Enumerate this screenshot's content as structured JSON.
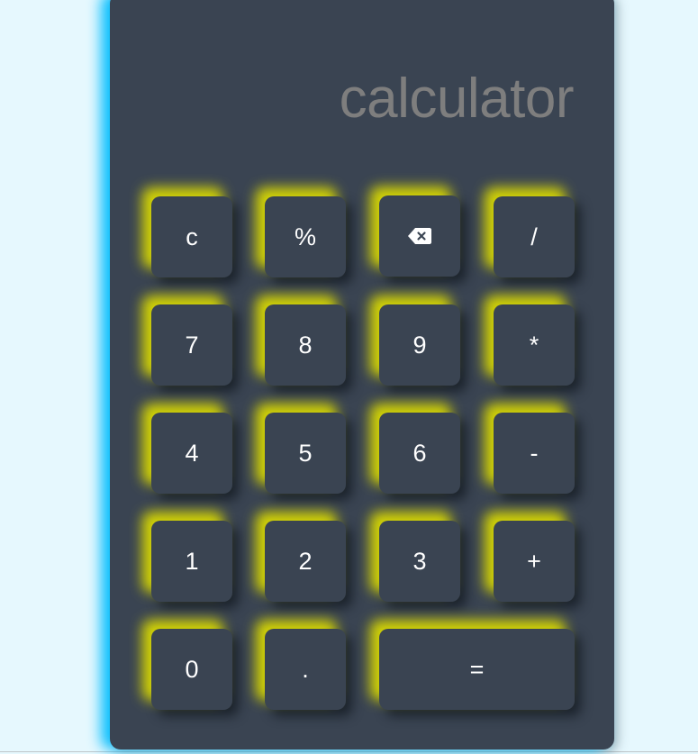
{
  "display": {
    "text": "calculator"
  },
  "keys": {
    "clear": "c",
    "percent": "%",
    "backspace_icon": "backspace-icon",
    "divide": "/",
    "seven": "7",
    "eight": "8",
    "nine": "9",
    "multiply": "*",
    "four": "4",
    "five": "5",
    "six": "6",
    "subtract": "-",
    "one": "1",
    "two": "2",
    "three": "3",
    "add": "+",
    "zero": "0",
    "decimal": ".",
    "equals": "="
  },
  "colors": {
    "page_background": "#e6f8fe",
    "calculator_body": "#3a4452",
    "display_text": "#7e7e7e",
    "key_text": "#ffffff",
    "key_glow": "#dcdc00",
    "edge_glow": "#00beff"
  }
}
